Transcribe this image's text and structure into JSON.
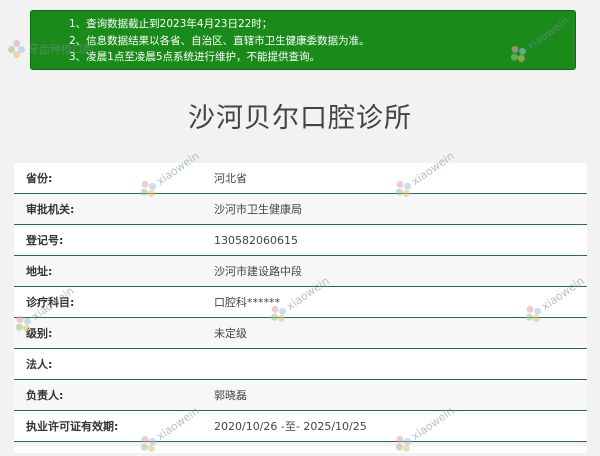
{
  "notice": {
    "lines": [
      "1、查询数据截止到2023年4月23日22时；",
      "2、信息数据结果以各省、自治区、直辖市卫生健康委数据为准。",
      "3、凌晨1点至凌晨5点系统进行维护，不能提供查询。"
    ]
  },
  "title": "沙河贝尔口腔诊所",
  "rows": [
    {
      "label": "省份:",
      "value": "河北省"
    },
    {
      "label": "审批机关:",
      "value": "沙河市卫生健康局"
    },
    {
      "label": "登记号:",
      "value": "130582060615"
    },
    {
      "label": "地址:",
      "value": "沙河市建设路中段"
    },
    {
      "label": "诊疗科目:",
      "value": "口腔科******"
    },
    {
      "label": "级别:",
      "value": "未定级"
    },
    {
      "label": "法人:",
      "value": ""
    },
    {
      "label": "负责人:",
      "value": "郭晓磊"
    },
    {
      "label": "执业许可证有效期:",
      "value": "2020/10/26 -至- 2025/10/25"
    }
  ],
  "watermark": {
    "text_latin": "xiaowein",
    "text_cn": "牙齿种植口腔"
  }
}
